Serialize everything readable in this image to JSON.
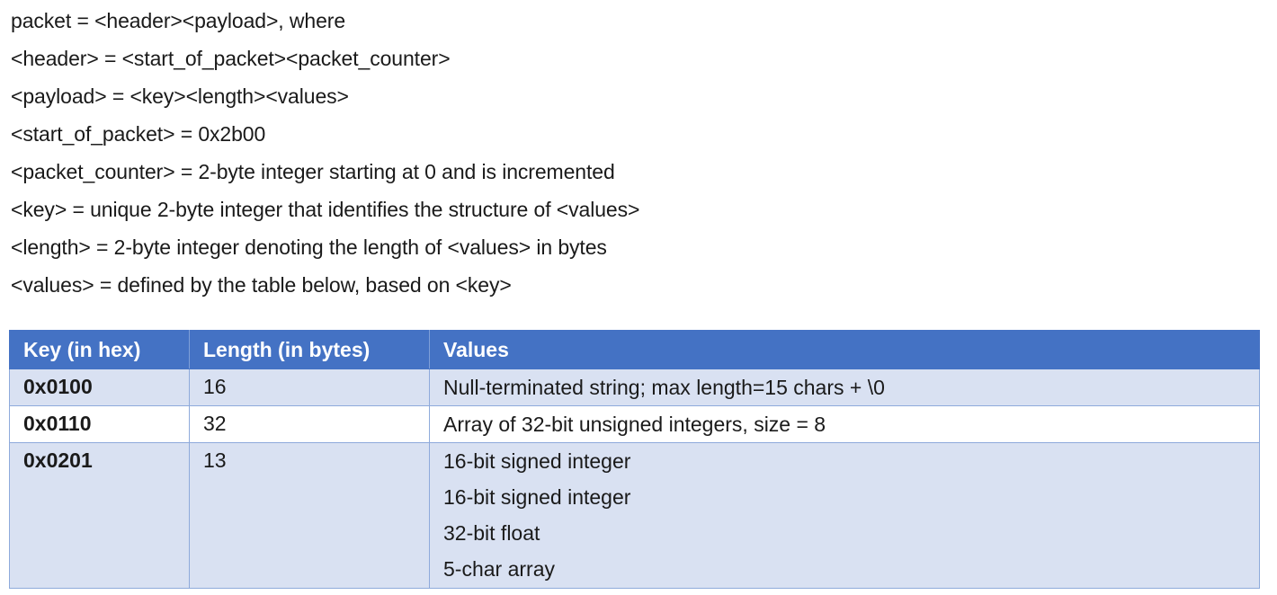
{
  "definitions": [
    "packet = <header><payload>, where",
    "<header> = <start_of_packet><packet_counter>",
    "<payload> = <key><length><values>",
    "<start_of_packet> = 0x2b00",
    "<packet_counter> = 2-byte integer starting at 0 and is incremented",
    "<key> = unique 2-byte integer that identifies the structure of <values>",
    "<length> = 2-byte integer denoting the length of <values> in bytes",
    "<values> = defined by the table below, based on <key>"
  ],
  "table": {
    "header_color": "#4472c4",
    "row_shade_color": "#d9e1f2",
    "headers": [
      "Key (in hex)",
      "Length (in bytes)",
      "Values"
    ],
    "rows": [
      {
        "key": "0x0100",
        "length": "16",
        "values": [
          "Null-terminated string; max length=15 chars + \\0"
        ]
      },
      {
        "key": "0x0110",
        "length": "32",
        "values": [
          "Array of 32-bit unsigned integers, size = 8"
        ]
      },
      {
        "key": "0x0201",
        "length": "13",
        "values": [
          "16-bit signed integer",
          "16-bit signed integer",
          "32-bit float",
          "5-char array"
        ]
      }
    ]
  }
}
